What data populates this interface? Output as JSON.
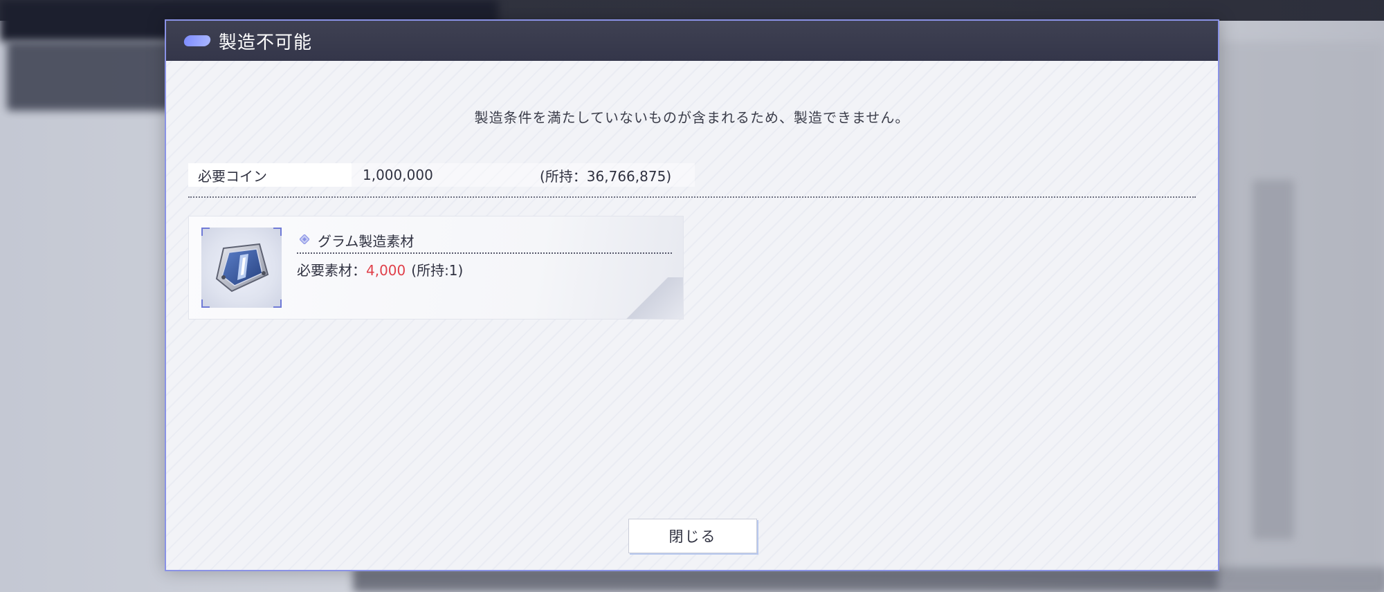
{
  "dialog": {
    "title": "製造不可能",
    "message": "製造条件を満たしていないものが含まれるため、製造できません。"
  },
  "coins": {
    "label": "必要コイン",
    "required": "1,000,000",
    "owned": "(所持：36,766,875)"
  },
  "material": {
    "name": "グラム製造素材",
    "icon": "gram-material-box-icon",
    "required_label": "必要素材：",
    "required_value": "4,000",
    "owned": "(所持:1)"
  },
  "buttons": {
    "close_label": "閉じる"
  },
  "colors": {
    "accent": "#8a92e6",
    "header_bg": "#3a3c4f",
    "insufficient": "#e0404a"
  }
}
